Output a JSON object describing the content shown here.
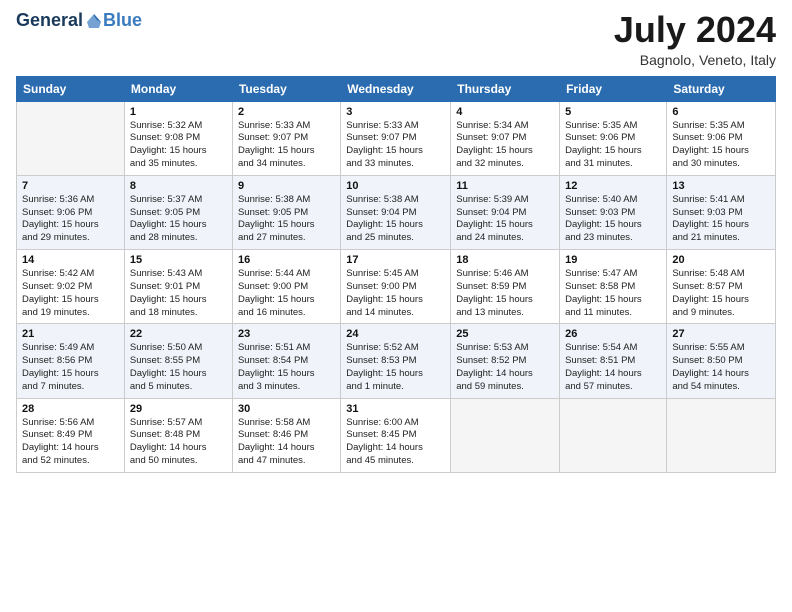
{
  "header": {
    "logo_general": "General",
    "logo_blue": "Blue",
    "title": "July 2024",
    "location": "Bagnolo, Veneto, Italy"
  },
  "weekdays": [
    "Sunday",
    "Monday",
    "Tuesday",
    "Wednesday",
    "Thursday",
    "Friday",
    "Saturday"
  ],
  "weeks": [
    [
      {
        "day": "",
        "info": ""
      },
      {
        "day": "1",
        "info": "Sunrise: 5:32 AM\nSunset: 9:08 PM\nDaylight: 15 hours\nand 35 minutes."
      },
      {
        "day": "2",
        "info": "Sunrise: 5:33 AM\nSunset: 9:07 PM\nDaylight: 15 hours\nand 34 minutes."
      },
      {
        "day": "3",
        "info": "Sunrise: 5:33 AM\nSunset: 9:07 PM\nDaylight: 15 hours\nand 33 minutes."
      },
      {
        "day": "4",
        "info": "Sunrise: 5:34 AM\nSunset: 9:07 PM\nDaylight: 15 hours\nand 32 minutes."
      },
      {
        "day": "5",
        "info": "Sunrise: 5:35 AM\nSunset: 9:06 PM\nDaylight: 15 hours\nand 31 minutes."
      },
      {
        "day": "6",
        "info": "Sunrise: 5:35 AM\nSunset: 9:06 PM\nDaylight: 15 hours\nand 30 minutes."
      }
    ],
    [
      {
        "day": "7",
        "info": "Sunrise: 5:36 AM\nSunset: 9:06 PM\nDaylight: 15 hours\nand 29 minutes."
      },
      {
        "day": "8",
        "info": "Sunrise: 5:37 AM\nSunset: 9:05 PM\nDaylight: 15 hours\nand 28 minutes."
      },
      {
        "day": "9",
        "info": "Sunrise: 5:38 AM\nSunset: 9:05 PM\nDaylight: 15 hours\nand 27 minutes."
      },
      {
        "day": "10",
        "info": "Sunrise: 5:38 AM\nSunset: 9:04 PM\nDaylight: 15 hours\nand 25 minutes."
      },
      {
        "day": "11",
        "info": "Sunrise: 5:39 AM\nSunset: 9:04 PM\nDaylight: 15 hours\nand 24 minutes."
      },
      {
        "day": "12",
        "info": "Sunrise: 5:40 AM\nSunset: 9:03 PM\nDaylight: 15 hours\nand 23 minutes."
      },
      {
        "day": "13",
        "info": "Sunrise: 5:41 AM\nSunset: 9:03 PM\nDaylight: 15 hours\nand 21 minutes."
      }
    ],
    [
      {
        "day": "14",
        "info": "Sunrise: 5:42 AM\nSunset: 9:02 PM\nDaylight: 15 hours\nand 19 minutes."
      },
      {
        "day": "15",
        "info": "Sunrise: 5:43 AM\nSunset: 9:01 PM\nDaylight: 15 hours\nand 18 minutes."
      },
      {
        "day": "16",
        "info": "Sunrise: 5:44 AM\nSunset: 9:00 PM\nDaylight: 15 hours\nand 16 minutes."
      },
      {
        "day": "17",
        "info": "Sunrise: 5:45 AM\nSunset: 9:00 PM\nDaylight: 15 hours\nand 14 minutes."
      },
      {
        "day": "18",
        "info": "Sunrise: 5:46 AM\nSunset: 8:59 PM\nDaylight: 15 hours\nand 13 minutes."
      },
      {
        "day": "19",
        "info": "Sunrise: 5:47 AM\nSunset: 8:58 PM\nDaylight: 15 hours\nand 11 minutes."
      },
      {
        "day": "20",
        "info": "Sunrise: 5:48 AM\nSunset: 8:57 PM\nDaylight: 15 hours\nand 9 minutes."
      }
    ],
    [
      {
        "day": "21",
        "info": "Sunrise: 5:49 AM\nSunset: 8:56 PM\nDaylight: 15 hours\nand 7 minutes."
      },
      {
        "day": "22",
        "info": "Sunrise: 5:50 AM\nSunset: 8:55 PM\nDaylight: 15 hours\nand 5 minutes."
      },
      {
        "day": "23",
        "info": "Sunrise: 5:51 AM\nSunset: 8:54 PM\nDaylight: 15 hours\nand 3 minutes."
      },
      {
        "day": "24",
        "info": "Sunrise: 5:52 AM\nSunset: 8:53 PM\nDaylight: 15 hours\nand 1 minute."
      },
      {
        "day": "25",
        "info": "Sunrise: 5:53 AM\nSunset: 8:52 PM\nDaylight: 14 hours\nand 59 minutes."
      },
      {
        "day": "26",
        "info": "Sunrise: 5:54 AM\nSunset: 8:51 PM\nDaylight: 14 hours\nand 57 minutes."
      },
      {
        "day": "27",
        "info": "Sunrise: 5:55 AM\nSunset: 8:50 PM\nDaylight: 14 hours\nand 54 minutes."
      }
    ],
    [
      {
        "day": "28",
        "info": "Sunrise: 5:56 AM\nSunset: 8:49 PM\nDaylight: 14 hours\nand 52 minutes."
      },
      {
        "day": "29",
        "info": "Sunrise: 5:57 AM\nSunset: 8:48 PM\nDaylight: 14 hours\nand 50 minutes."
      },
      {
        "day": "30",
        "info": "Sunrise: 5:58 AM\nSunset: 8:46 PM\nDaylight: 14 hours\nand 47 minutes."
      },
      {
        "day": "31",
        "info": "Sunrise: 6:00 AM\nSunset: 8:45 PM\nDaylight: 14 hours\nand 45 minutes."
      },
      {
        "day": "",
        "info": ""
      },
      {
        "day": "",
        "info": ""
      },
      {
        "day": "",
        "info": ""
      }
    ]
  ]
}
